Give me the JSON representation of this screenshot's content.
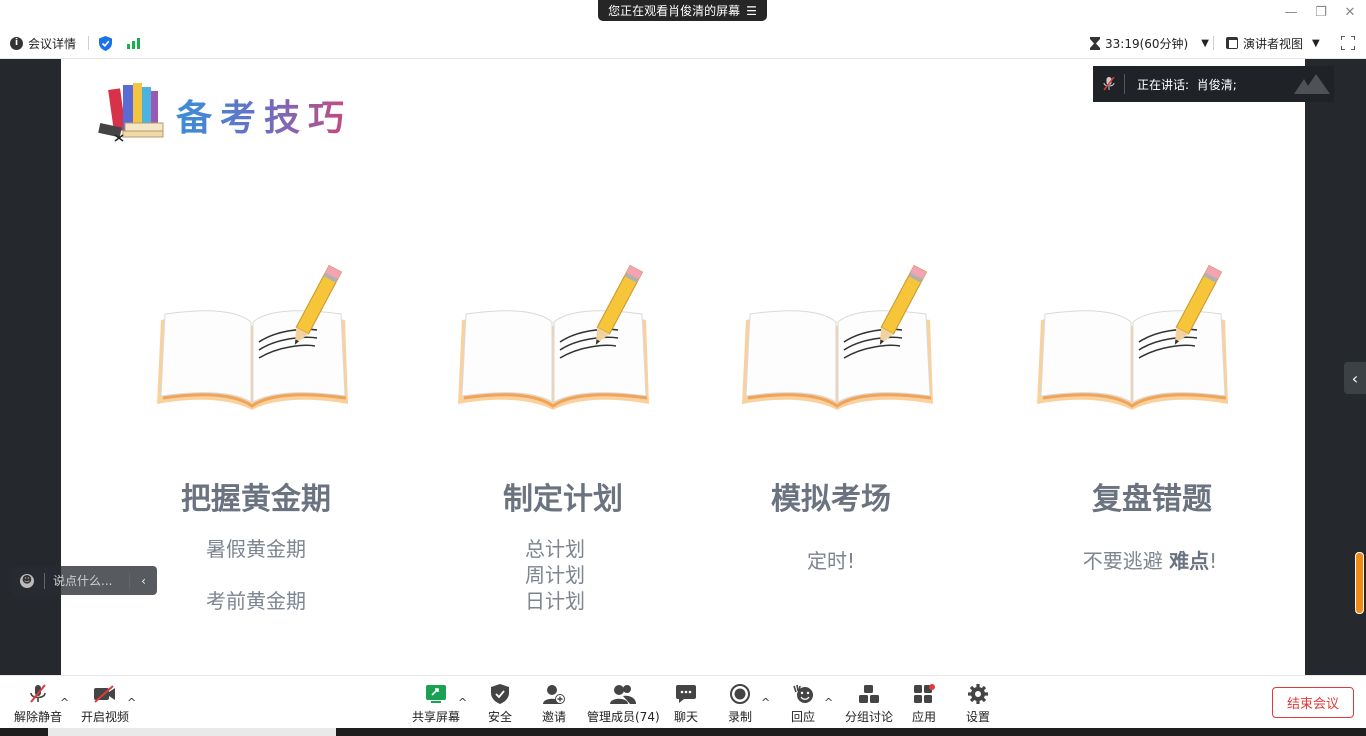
{
  "banner": {
    "text": "您正在观看肖俊清的屏幕",
    "menu_icon": "menu-icon"
  },
  "window_controls": {
    "minimize": "—",
    "restore": "❐",
    "close": "✕"
  },
  "toolbar": {
    "meeting_info": "会议详情",
    "timer": "33:19(60分钟)",
    "view_mode": "演讲者视图"
  },
  "slide": {
    "title": "备考技巧",
    "columns": [
      {
        "heading": "把握黄金期",
        "lines": [
          "暑假黄金期",
          "考前黄金期"
        ]
      },
      {
        "heading": "制定计划",
        "lines": [
          "总计划",
          "周计划",
          "日计划"
        ]
      },
      {
        "heading": "模拟考场",
        "lines": [
          "定时!"
        ]
      },
      {
        "heading": "复盘错题",
        "lines_prefix": "不要逃避",
        "lines_bold": "难点",
        "lines_suffix": "!"
      }
    ]
  },
  "speaking": {
    "label": "正在讲话:",
    "name": "肖俊清;"
  },
  "chat": {
    "placeholder": "说点什么..."
  },
  "bottombar": {
    "unmute": "解除静音",
    "start_video": "开启视频",
    "share_screen": "共享屏幕",
    "security": "安全",
    "invite": "邀请",
    "participants": "管理成员(74)",
    "chat": "聊天",
    "record": "录制",
    "reactions": "回应",
    "breakout": "分组讨论",
    "apps": "应用",
    "settings": "设置",
    "end_meeting": "结束会议"
  },
  "colors": {
    "accent_green": "#17b14a",
    "end_red": "#e03a3a",
    "share_green": "#1aa152",
    "dark_side": "#25292e",
    "scroll_orange": "#f18b13"
  }
}
